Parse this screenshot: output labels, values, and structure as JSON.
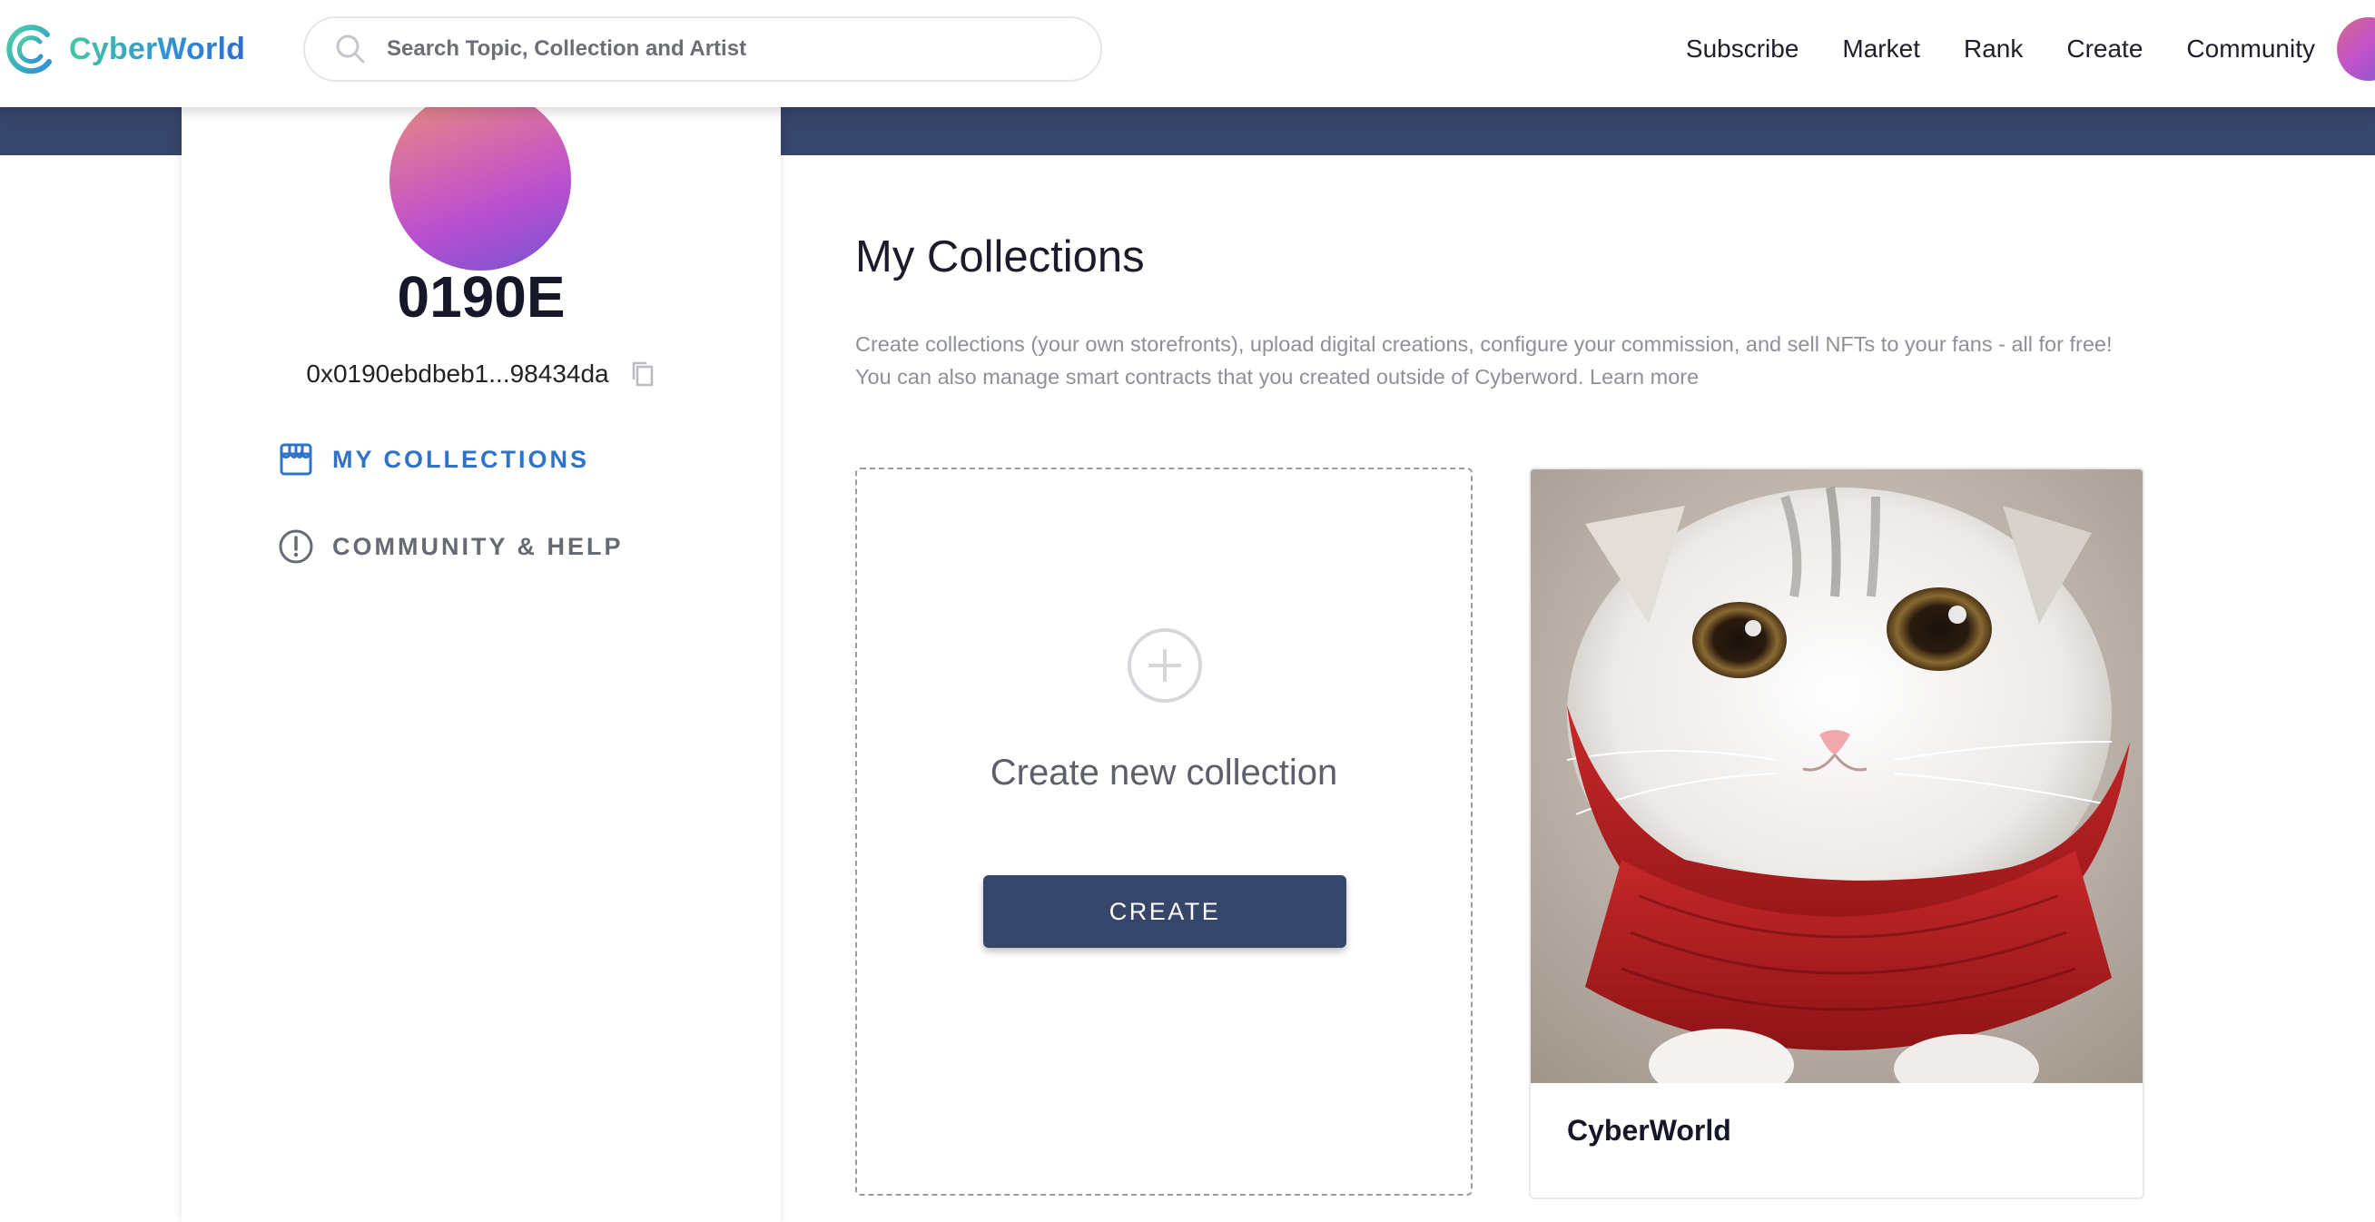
{
  "app": {
    "brand": "CyberWorld",
    "brand_colors": [
      "#45c6a0",
      "#2f8fd6"
    ]
  },
  "header": {
    "search_placeholder": "Search Topic, Collection and Artist",
    "nav": [
      "Subscribe",
      "Market",
      "Rank",
      "Create",
      "Community"
    ]
  },
  "profile": {
    "name": "0190E",
    "wallet": "0x0190ebdbeb1...98434da"
  },
  "sidebar": {
    "items": [
      {
        "label": "MY COLLECTIONS",
        "icon": "storefront-icon",
        "active": true
      },
      {
        "label": "COMMUNITY & HELP",
        "icon": "alert-circle-icon",
        "active": false
      }
    ]
  },
  "main": {
    "title": "My Collections",
    "description_line1": "Create collections (your own storefronts), upload digital creations, configure your commission, and sell NFTs to your fans - all for free!",
    "description_line2": "You can also manage smart contracts that you created outside of Cyberword. Learn more",
    "create_card": {
      "text": "Create new collection",
      "button": "CREATE"
    },
    "collections": [
      {
        "name": "CyberWorld",
        "image": "white-kitten-red-scarf"
      }
    ]
  },
  "colors": {
    "primary_dark": "#36456a",
    "active_link": "#2f73c9",
    "muted_text": "#8d9097"
  }
}
